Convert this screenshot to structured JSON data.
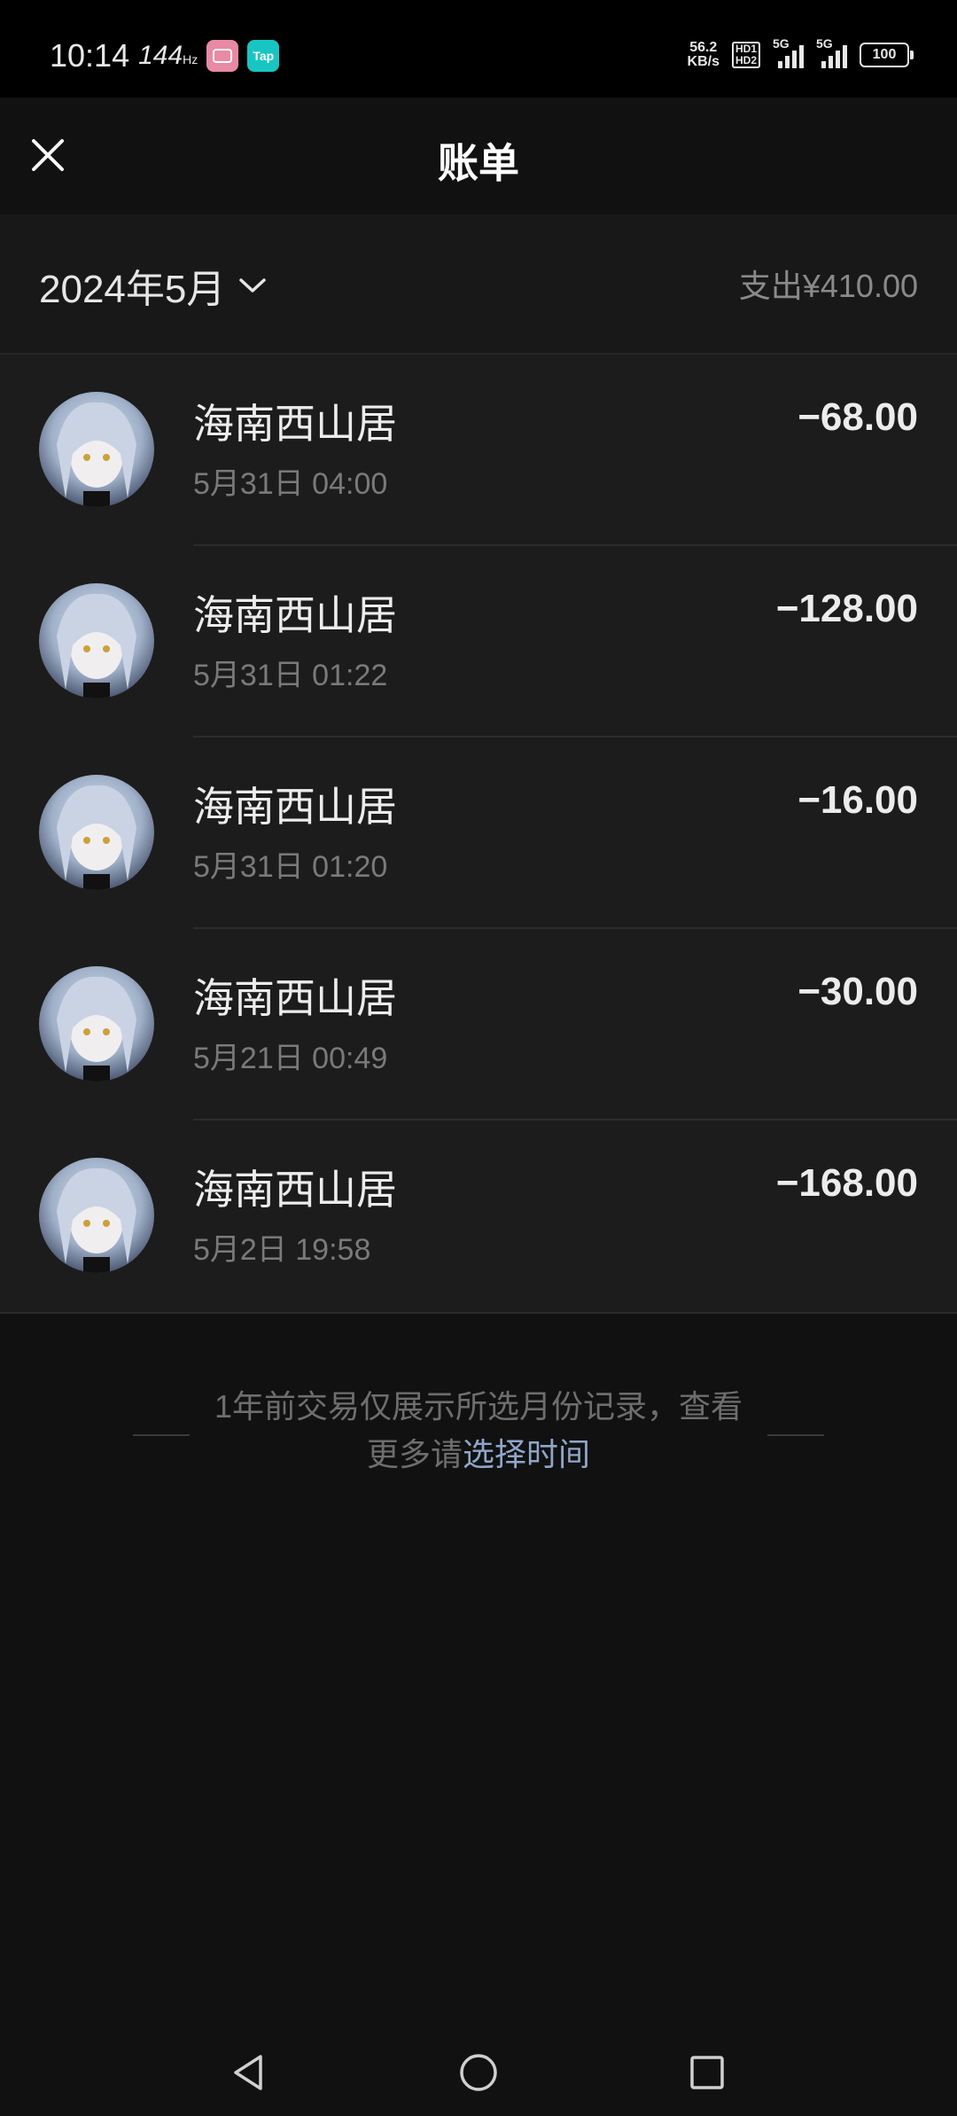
{
  "status_bar": {
    "time": "10:14",
    "refresh_rate": "144",
    "refresh_unit": "Hz",
    "app_badge_tap": "Tap",
    "net_speed_value": "56.2",
    "net_speed_unit": "KB/s",
    "hd_top": "HD1",
    "hd_bottom": "HD2",
    "sig1_label": "5G",
    "sig2_label": "5G",
    "battery": "100"
  },
  "header": {
    "title": "账单"
  },
  "month_bar": {
    "month": "2024年5月",
    "expense_label": "支出",
    "expense_amount": "¥410.00"
  },
  "transactions": [
    {
      "merchant": "海南西山居",
      "time": "5月31日 04:00",
      "amount": "−68.00"
    },
    {
      "merchant": "海南西山居",
      "time": "5月31日 01:22",
      "amount": "−128.00"
    },
    {
      "merchant": "海南西山居",
      "time": "5月31日 01:20",
      "amount": "−16.00"
    },
    {
      "merchant": "海南西山居",
      "time": "5月21日 00:49",
      "amount": "−30.00"
    },
    {
      "merchant": "海南西山居",
      "time": "5月2日 19:58",
      "amount": "−168.00"
    }
  ],
  "footnote": {
    "text": "1年前交易仅展示所选月份记录，查看更多请",
    "link": "选择时间"
  },
  "colors": {
    "background": "#111111",
    "list_bg": "#1c1c1c",
    "link": "#8fa6c8"
  }
}
